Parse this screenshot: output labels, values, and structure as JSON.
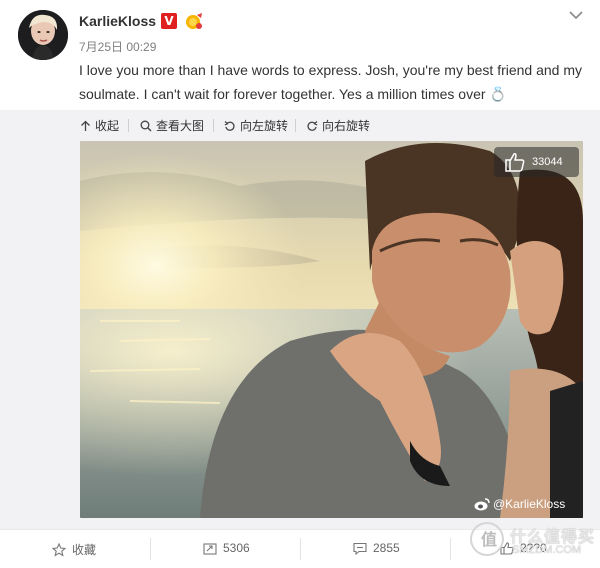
{
  "user": {
    "name": "KarlieKloss",
    "verified_badge": "V",
    "timestamp": "7月25日 00:29"
  },
  "post": {
    "text": "I love you more than I have words to express. Josh, you're my best friend and my soulmate. I can't wait for forever together. Yes a million times over 💍"
  },
  "toolbar": {
    "collapse_label": "收起",
    "view_large_label": "查看大图",
    "rotate_left_label": "向左旋转",
    "rotate_right_label": "向右旋转"
  },
  "image": {
    "like_count": "33044",
    "watermark": "@KarlieKloss"
  },
  "actions": {
    "favorite_label": "收藏",
    "repost_count": "5306",
    "comment_count": "2855",
    "like_count": "2??0"
  },
  "site_watermark": {
    "name": "什么值得买",
    "url": "SMZDM.COM"
  },
  "colors": {
    "background": "#ffffff",
    "toolbar_bg": "#f2f2f5",
    "verified_red": "#e02020",
    "text": "#333333",
    "muted": "#808080"
  }
}
